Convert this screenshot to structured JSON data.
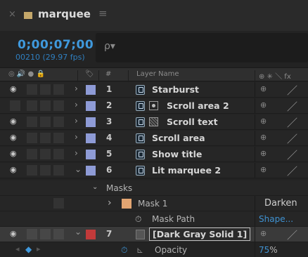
{
  "tab": {
    "close_glyph": "×",
    "swatch_color": "#c4a76a",
    "title": "marquee",
    "menu_glyph": "≡"
  },
  "timecode": {
    "value": "0;00;07;00",
    "frames": "00210 (29.97 fps)",
    "search_glyph": "ρ▾"
  },
  "columns": {
    "switch_icons": "◎ 🔊 ● 🔒",
    "label_icon": "🏷",
    "number": "#",
    "layer_name": "Layer Name",
    "switches": "⊕ ✳ ＼ fx"
  },
  "layers": [
    {
      "number": "1",
      "name": "Starburst",
      "label_color": "#8e9bd6",
      "visible": true,
      "type": "precomp",
      "second_icon": ""
    },
    {
      "number": "2",
      "name": "Scroll area 2",
      "label_color": "#8e9bd6",
      "visible": false,
      "type": "precomp",
      "second_icon": "dot"
    },
    {
      "number": "3",
      "name": "Scroll text",
      "label_color": "#8e9bd6",
      "visible": true,
      "type": "precomp",
      "second_icon": "grid"
    },
    {
      "number": "4",
      "name": "Scroll area",
      "label_color": "#8e9bd6",
      "visible": true,
      "type": "precomp",
      "second_icon": ""
    },
    {
      "number": "5",
      "name": "Show title",
      "label_color": "#8e9bd6",
      "visible": true,
      "type": "precomp",
      "second_icon": ""
    },
    {
      "number": "6",
      "name": "Lit marquee 2",
      "label_color": "#8e9bd6",
      "visible": true,
      "type": "precomp",
      "second_icon": ""
    }
  ],
  "masks": {
    "group_label": "Masks",
    "mask1_label": "Mask 1",
    "mask1_color": "#e2a572",
    "mask1_mode": "Darken",
    "mask_path_label": "Mask Path",
    "mask_path_value": "Shape..."
  },
  "layer7": {
    "number": "7",
    "name": "[Dark Gray Solid 1]",
    "label_color": "#c23a3a"
  },
  "opacity": {
    "label": "Opacity",
    "value": "75",
    "unit": "%"
  },
  "icons": {
    "eye": "👁",
    "twirl_closed": "›",
    "twirl_open": "⌄",
    "stopwatch": "⏱",
    "graph": "📈",
    "parent_pick": "⊕",
    "slash": "／",
    "fx": "fx"
  }
}
